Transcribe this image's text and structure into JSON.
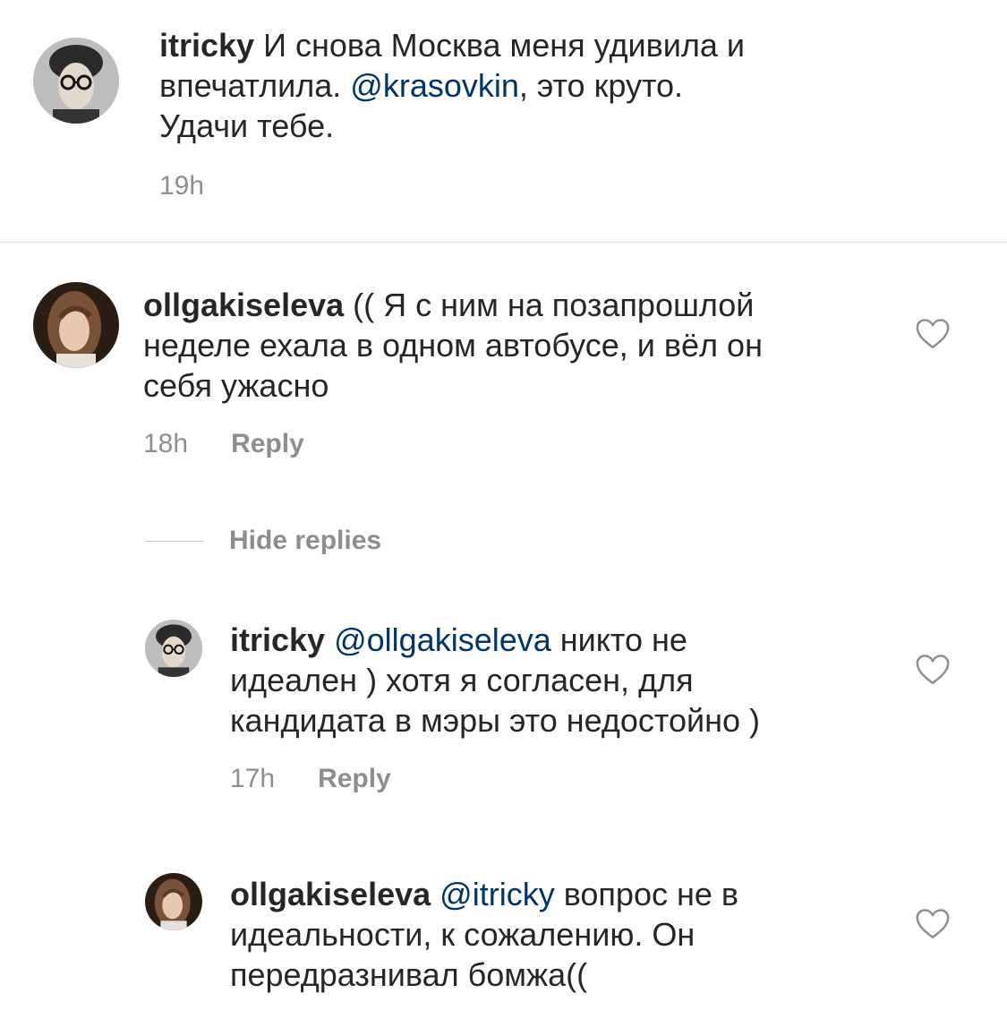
{
  "caption": {
    "username": "itricky",
    "text_part1": "И снова Москва меня удивила и",
    "text_line2_prefix": "впечатлила. ",
    "mention": "@krasovkin",
    "text_line2_suffix": ", это круто.",
    "text_line3": "Удачи тебе.",
    "time": "19h"
  },
  "comments": [
    {
      "username": "ollgakiseleva",
      "line1": "(( Я с ним на позапрошлой",
      "line2": "неделе ехала в одном автобусе, и вёл он",
      "line3": "себя ужасно",
      "time": "18h",
      "reply_label": "Reply"
    }
  ],
  "hide_replies_label": "Hide replies",
  "replies": [
    {
      "username": "itricky",
      "mention": "@ollgakiseleva",
      "line1_suffix": " никто не",
      "line2": "идеален ) хотя я согласен, для",
      "line3": "кандидата в мэры это недостойно )",
      "time": "17h",
      "reply_label": "Reply"
    },
    {
      "username": "ollgakiseleva",
      "mention": "@itricky",
      "line1_suffix": " вопрос не в",
      "line2": "идеальности, к сожалению. Он",
      "line3": "передразнивал бомжа(("
    }
  ],
  "colors": {
    "text": "#262626",
    "mention": "#003569",
    "meta": "#8e8e8e",
    "divider": "#dbdbdb"
  },
  "icons": {
    "like": "heart-outline-icon"
  }
}
